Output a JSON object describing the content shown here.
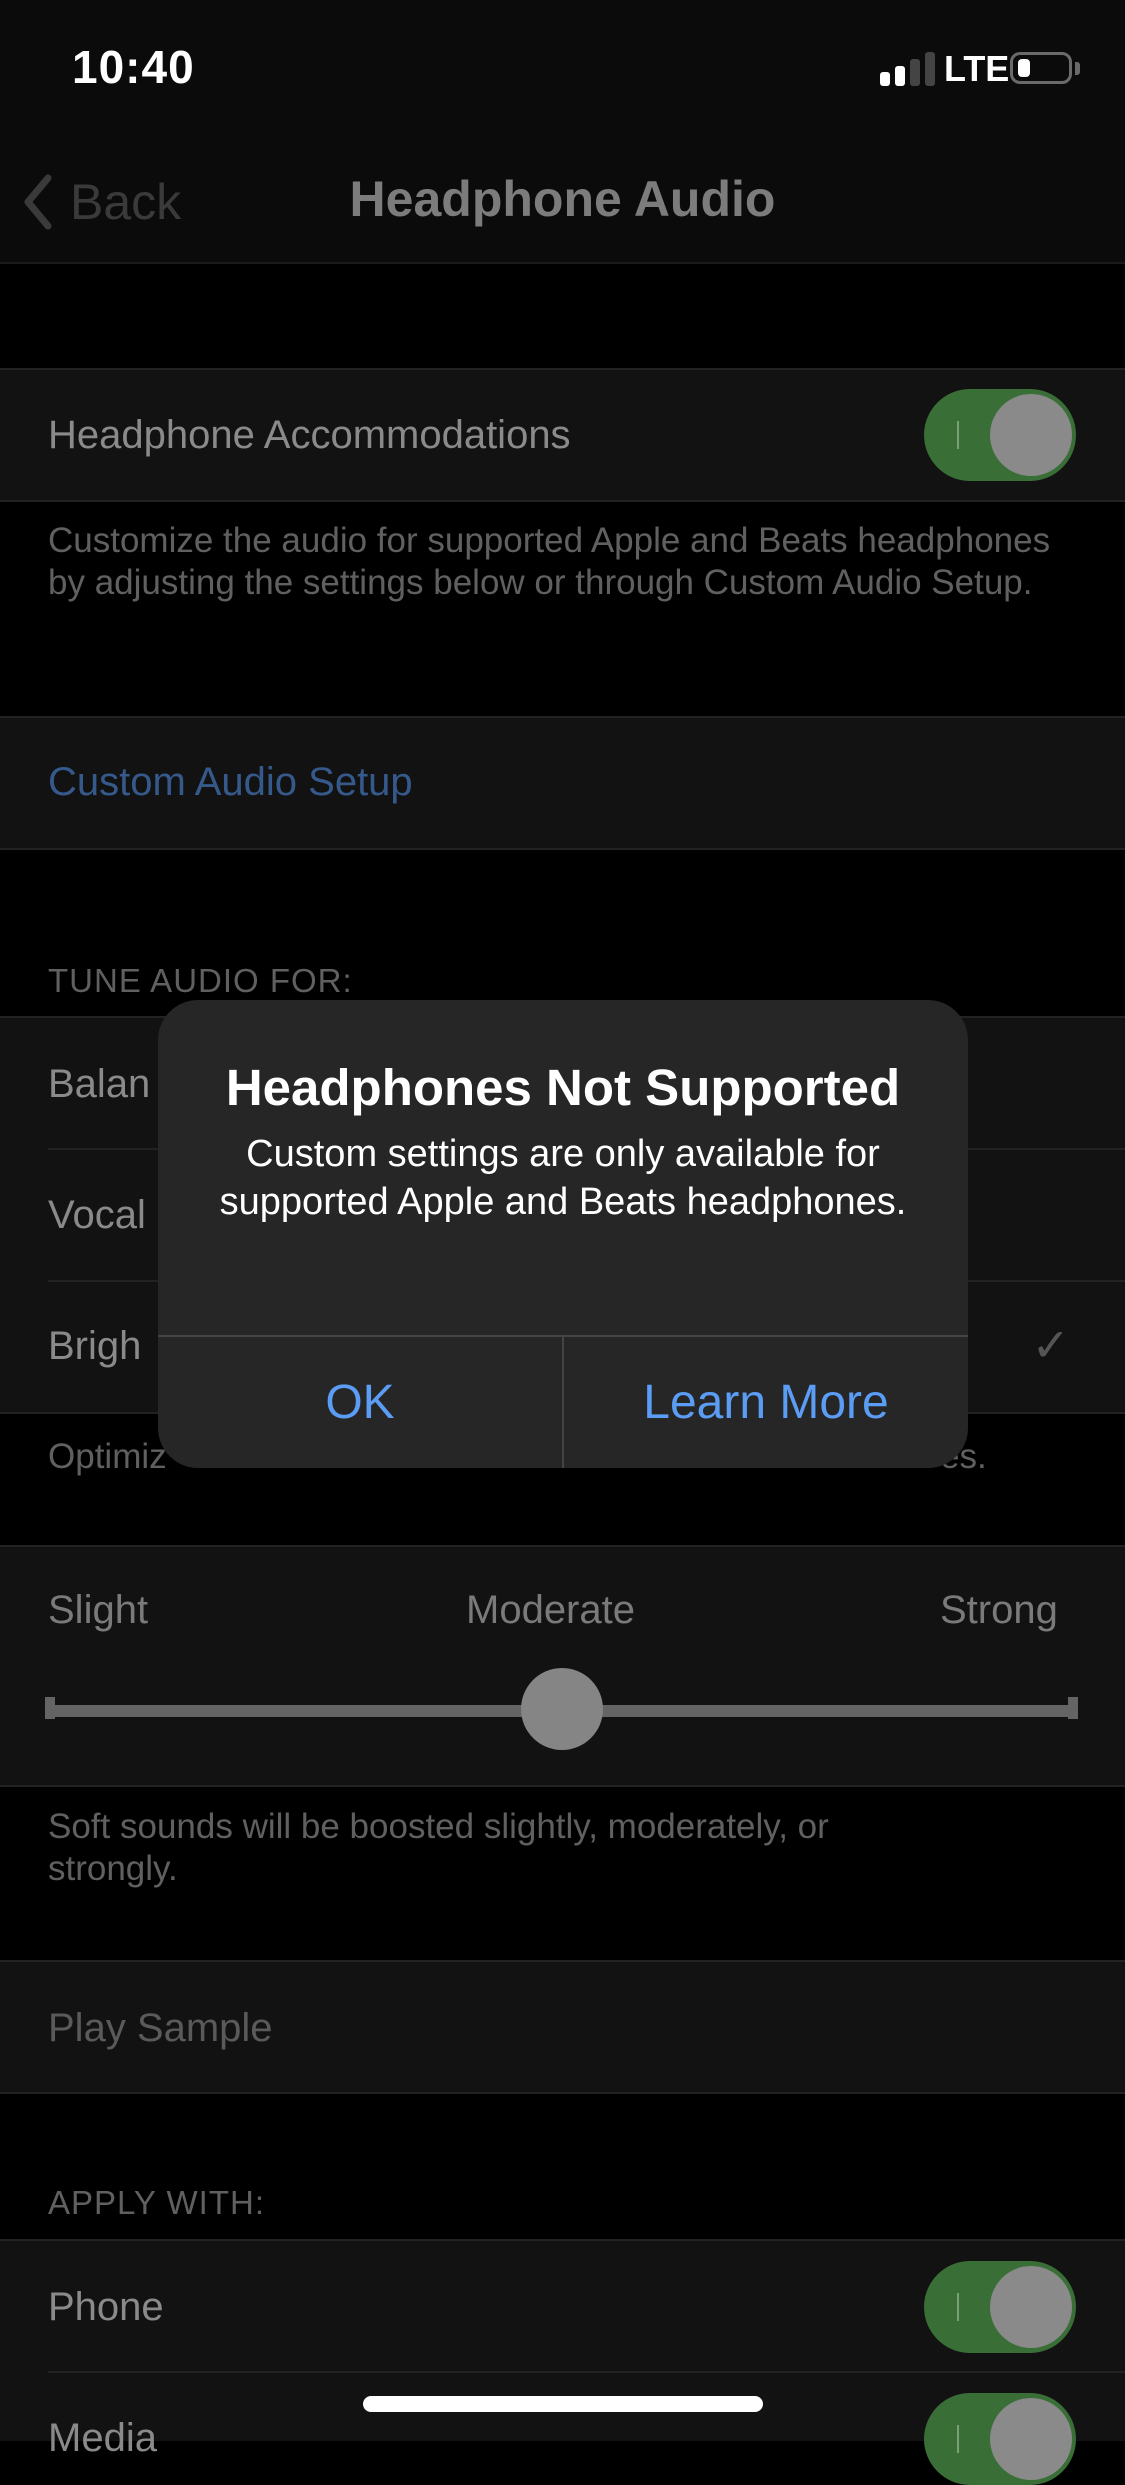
{
  "status_bar": {
    "time": "10:40",
    "network": "LTE",
    "signal_bars_active": 2,
    "signal_bars_total": 4,
    "battery_level_fraction": 0.15
  },
  "nav": {
    "back_label": "Back",
    "title": "Headphone Audio"
  },
  "accommodations": {
    "label": "Headphone Accommodations",
    "enabled": true,
    "footer": "Customize the audio for supported Apple and Beats headphones by adjusting the settings below or through Custom Audio Setup."
  },
  "custom_audio_setup": {
    "label": "Custom Audio Setup"
  },
  "tune_audio": {
    "header": "TUNE AUDIO FOR:",
    "options": [
      {
        "label": "Balan",
        "selected": false
      },
      {
        "label": "Vocal",
        "selected": false
      },
      {
        "label": "Brigh",
        "selected": true
      }
    ],
    "footer_left": "Optimiz",
    "footer_right": "es."
  },
  "boost": {
    "labels": [
      "Slight",
      "Moderate",
      "Strong"
    ],
    "value": "Moderate",
    "position_fraction": 0.5,
    "footer": "Soft sounds will be boosted slightly, moderately, or strongly."
  },
  "play_sample": {
    "label": "Play Sample"
  },
  "apply_with": {
    "header": "APPLY WITH:",
    "items": [
      {
        "label": "Phone",
        "enabled": true
      },
      {
        "label": "Media",
        "enabled": true
      }
    ]
  },
  "alert": {
    "title": "Headphones Not Supported",
    "message": "Custom settings are only available for supported Apple and Beats headphones.",
    "buttons": {
      "ok": "OK",
      "learn_more": "Learn More"
    }
  },
  "colors": {
    "toggle_on": "#3a6e37",
    "alert_button": "#5b9df5",
    "link": "#36598c"
  },
  "icons": {
    "back": "chevron-left",
    "check": "checkmark"
  }
}
